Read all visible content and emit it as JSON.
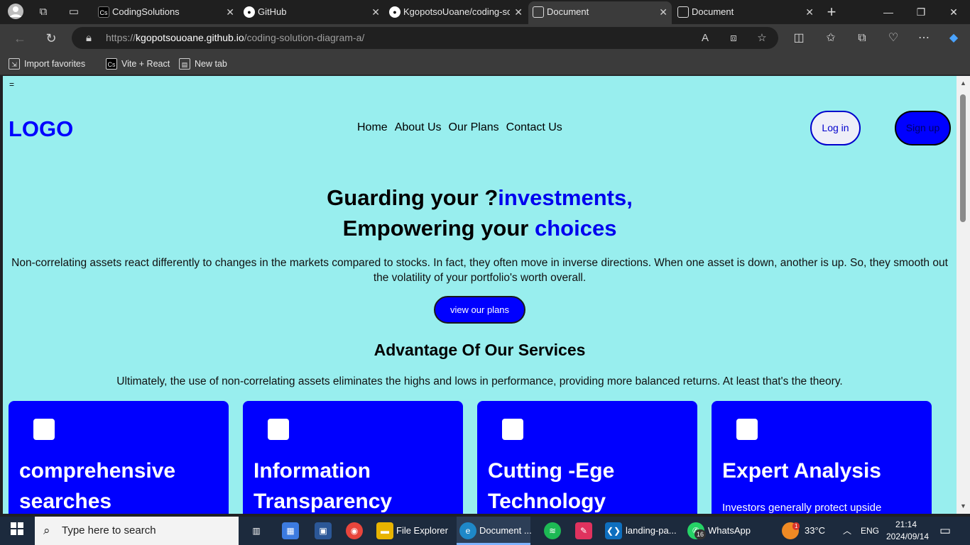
{
  "browser": {
    "tabs": [
      {
        "title": "CodingSolutions"
      },
      {
        "title": "GitHub"
      },
      {
        "title": "KgopotsoUoane/coding-sc"
      },
      {
        "title": "Document"
      },
      {
        "title": "Document"
      }
    ],
    "url_prefix": "https://",
    "url_host": "kgopotsouoane.github.io",
    "url_path": "/coding-solution-diagram-a/",
    "favorites": [
      {
        "label": "Import favorites"
      },
      {
        "label": "Vite + React"
      },
      {
        "label": "New tab"
      }
    ]
  },
  "page": {
    "menu_toggle": "=",
    "logo": "LOGO",
    "nav": [
      "Home",
      "About Us",
      "Our Plans",
      "Contact Us"
    ],
    "login_label": "Log in",
    "signup_label": "Sign up",
    "hero_line1_plain": "Guarding your ?",
    "hero_line1_accent": "investments,",
    "hero_line2_plain": "Empowering your ",
    "hero_line2_accent": "choices",
    "hero_paragraph": "Non-correlating assets react differently to changes in the markets compared to stocks. In fact, they often move in inverse directions. When one asset is down, another is up. So, they smooth out the volatility of your portfolio's worth overall.",
    "cta_label": "view our plans",
    "advantage_heading": "Advantage Of Our Services",
    "advantage_paragraph": "Ultimately, the use of non-correlating assets eliminates the highs and lows in performance, providing more balanced returns. At least that's the theory.",
    "cards": [
      {
        "title": "comprehensive searches",
        "text": ""
      },
      {
        "title": "Information Transparency",
        "text": ""
      },
      {
        "title": "Cutting -Ege Technology",
        "text": ""
      },
      {
        "title": "Expert Analysis",
        "text": "Investors generally protect upside"
      }
    ]
  },
  "taskbar": {
    "search_placeholder": "Type here to search",
    "apps": [
      {
        "label": "File Explorer"
      },
      {
        "label": "Document ..."
      },
      {
        "label": "landing-pa..."
      },
      {
        "label": "WhatsApp"
      }
    ],
    "whatsapp_badge": "16",
    "weather_badge": "1",
    "temperature": "33°C",
    "language": "ENG",
    "time": "21:14",
    "date": "2024/09/14"
  },
  "colors": {
    "page_bg": "#98eeee",
    "accent_blue": "#0000ff",
    "browser_dark": "#1f1f1f",
    "taskbar": "#1c2a3d"
  }
}
